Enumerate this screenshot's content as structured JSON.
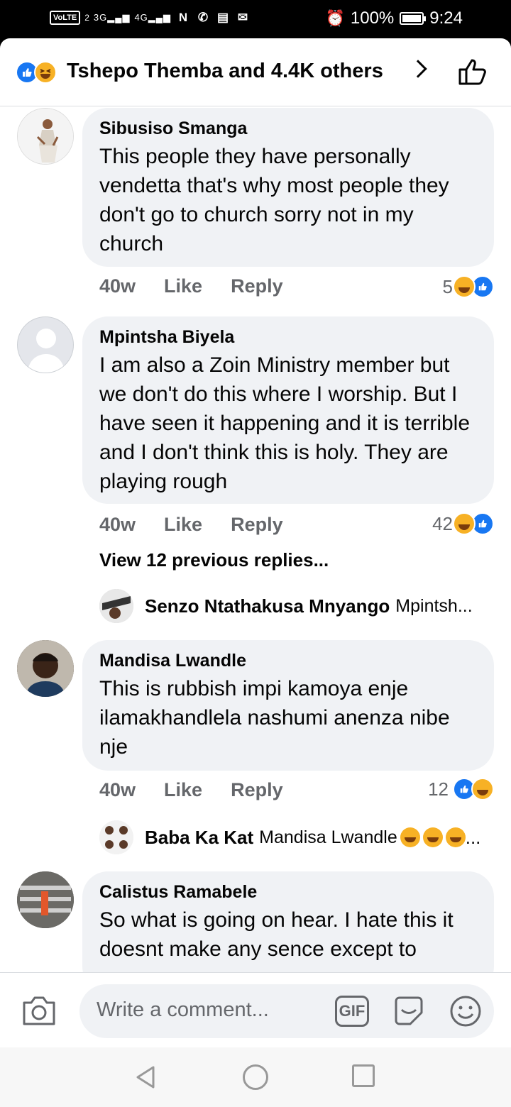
{
  "status_bar": {
    "volte": "VoLTE",
    "sim": "2",
    "net1": "3G",
    "net2": "4G",
    "battery": "100%",
    "time": "9:24"
  },
  "header": {
    "reactors_text": "Tshepo Themba and 4.4K others"
  },
  "comments": [
    {
      "name": "Sibusiso Smanga",
      "text": "This people they have personally vendetta that's why most people they don't go to church sorry not in my church",
      "time": "40w",
      "like": "Like",
      "reply": "Reply",
      "reaction_count": "5",
      "reactions": [
        "haha",
        "like"
      ]
    },
    {
      "name": "Mpintsha Biyela",
      "text": "I am also a Zoin Ministry member but we don't do this where I worship. But I have seen it happening and it is terrible and I don't think this is holy. They are playing rough",
      "time": "40w",
      "like": "Like",
      "reply": "Reply",
      "reaction_count": "42",
      "reactions": [
        "haha",
        "like"
      ],
      "view_previous": "View 12 previous replies...",
      "last_reply": {
        "name": "Senzo Ntathakusa Mnyango",
        "snippet": "Mpintsh..."
      }
    },
    {
      "name": "Mandisa Lwandle",
      "text": "This is rubbish impi kamoya enje ilamakhandlela nashumi anenza nibe nje",
      "time": "40w",
      "like": "Like",
      "reply": "Reply",
      "reaction_count": "12",
      "reactions": [
        "like",
        "haha"
      ],
      "last_reply": {
        "name": "Baba Ka Kat",
        "snippet": "Mandisa Lwandle",
        "trail": "..."
      }
    },
    {
      "name": "Calistus Ramabele",
      "text": "So what is going on hear. I hate this it doesnt make any sence except to"
    }
  ],
  "composer": {
    "placeholder": "Write a comment...",
    "gif": "GIF"
  },
  "colors": {
    "facebook_blue": "#1877f2",
    "bubble": "#f0f2f5",
    "secondary_text": "#65676b",
    "haha_yellow": "#f7b125"
  }
}
